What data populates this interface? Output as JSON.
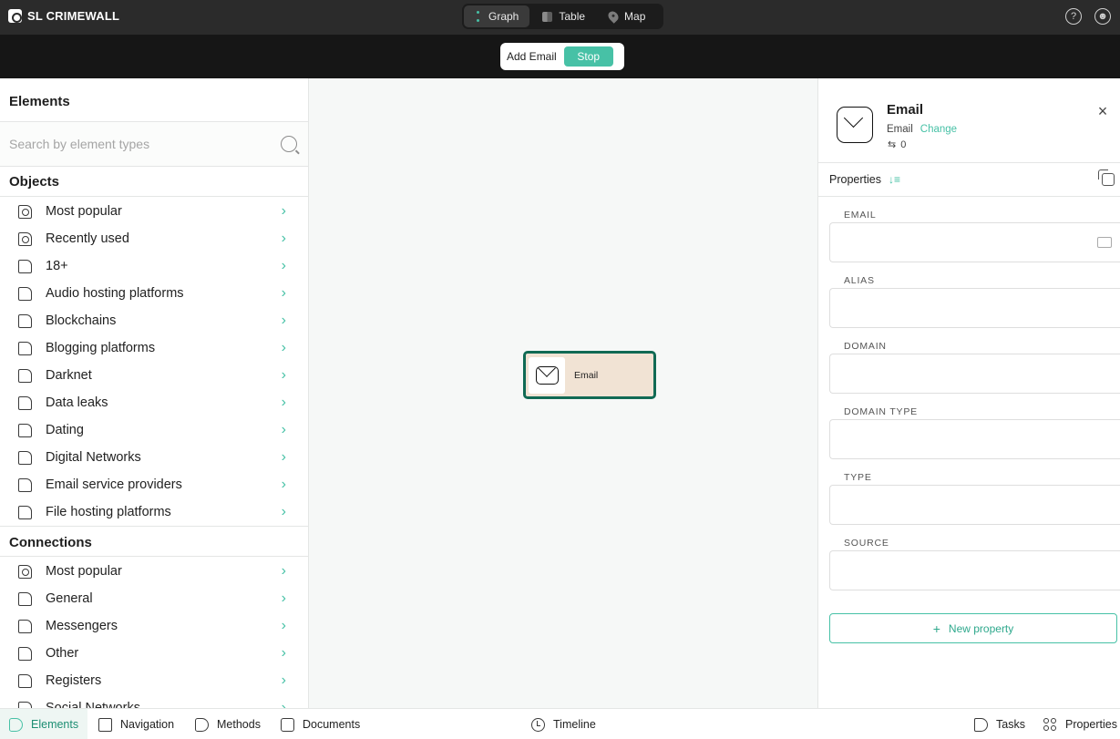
{
  "app": {
    "name": "SL CRIMEWALL"
  },
  "views": [
    {
      "label": "Graph",
      "icon": "graph-icon",
      "active": true
    },
    {
      "label": "Table",
      "icon": "table-icon",
      "active": false
    },
    {
      "label": "Map",
      "icon": "map-pin-icon",
      "active": false
    }
  ],
  "topbar": {
    "help_icon": "help-icon",
    "account_icon": "account-icon"
  },
  "action": {
    "label": "Add Email",
    "stop_label": "Stop",
    "accent": "#47c1a6"
  },
  "sidebar": {
    "title": "Elements",
    "search_placeholder": "Search by element types",
    "objects_title": "Objects",
    "objects": [
      {
        "label": "Most popular",
        "icon": "star-folder-icon"
      },
      {
        "label": "Recently used",
        "icon": "clock-folder-icon"
      },
      {
        "label": "18+",
        "icon": "folder-icon"
      },
      {
        "label": "Audio hosting platforms",
        "icon": "folder-icon"
      },
      {
        "label": "Blockchains",
        "icon": "folder-icon"
      },
      {
        "label": "Blogging platforms",
        "icon": "folder-icon"
      },
      {
        "label": "Darknet",
        "icon": "folder-icon"
      },
      {
        "label": "Data leaks",
        "icon": "folder-icon"
      },
      {
        "label": "Dating",
        "icon": "folder-icon"
      },
      {
        "label": "Digital Networks",
        "icon": "folder-icon"
      },
      {
        "label": "Email service providers",
        "icon": "folder-icon"
      },
      {
        "label": "File hosting platforms",
        "icon": "folder-icon"
      }
    ],
    "connections_title": "Connections",
    "connections": [
      {
        "label": "Most popular",
        "icon": "star-folder-icon"
      },
      {
        "label": "General",
        "icon": "folder-icon"
      },
      {
        "label": "Messengers",
        "icon": "folder-icon"
      },
      {
        "label": "Other",
        "icon": "folder-icon"
      },
      {
        "label": "Registers",
        "icon": "folder-icon"
      },
      {
        "label": "Social Networks",
        "icon": "folder-icon"
      }
    ]
  },
  "canvas": {
    "node": {
      "label": "Email",
      "icon": "envelope-icon",
      "border_color": "#116a54",
      "fill": "#f1e3d4"
    }
  },
  "details": {
    "title": "Email",
    "type": "Email",
    "change_label": "Change",
    "connections_count": "0",
    "properties_label": "Properties",
    "fields": [
      {
        "label": "EMAIL",
        "value": ""
      },
      {
        "label": "ALIAS",
        "value": ""
      },
      {
        "label": "DOMAIN",
        "value": ""
      },
      {
        "label": "DOMAIN TYPE",
        "value": ""
      },
      {
        "label": "TYPE",
        "value": ""
      },
      {
        "label": "SOURCE",
        "value": ""
      }
    ],
    "new_property_label": "New property"
  },
  "bottom": {
    "left_tabs": [
      {
        "label": "Elements",
        "icon": "elements-icon",
        "active": true
      },
      {
        "label": "Navigation",
        "icon": "cube-icon",
        "active": false
      },
      {
        "label": "Methods",
        "icon": "tag-icon",
        "active": false
      },
      {
        "label": "Documents",
        "icon": "documents-icon",
        "active": false
      }
    ],
    "timeline_label": "Timeline",
    "tasks_label": "Tasks",
    "properties_label": "Properties"
  }
}
